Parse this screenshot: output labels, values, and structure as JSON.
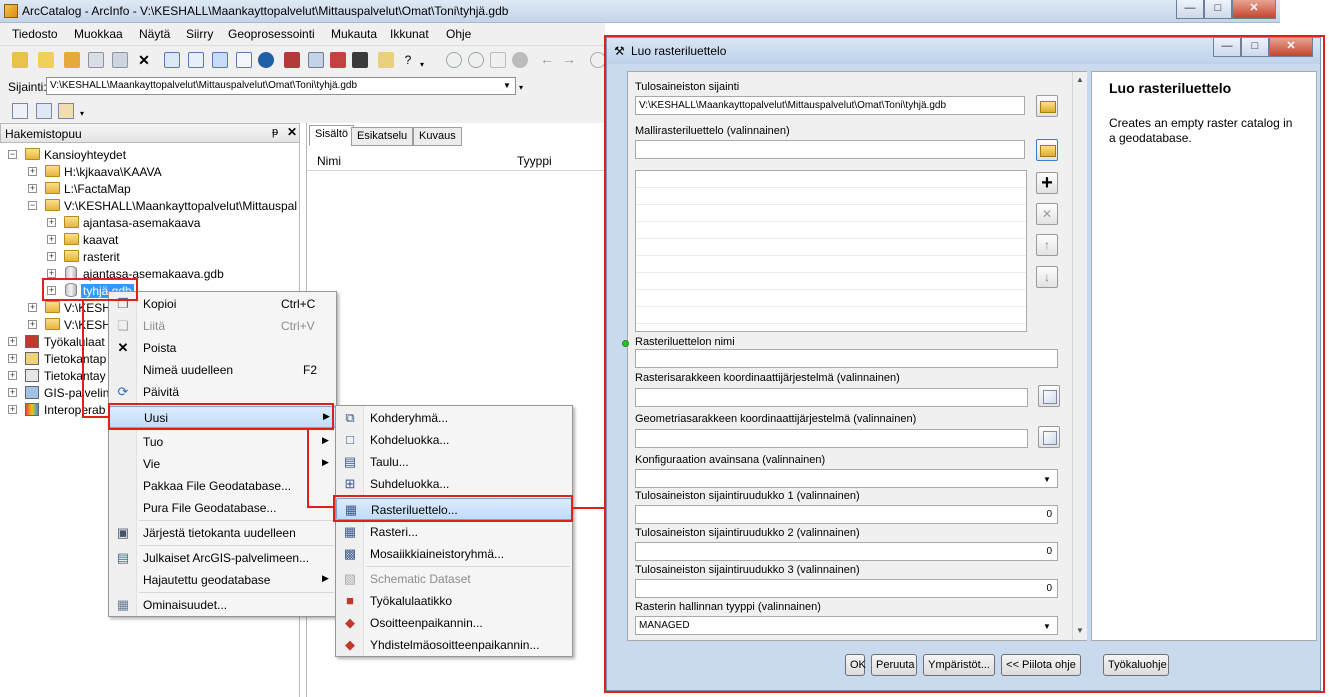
{
  "window": {
    "title": "ArcCatalog - ArcInfo - V:\\KESHALL\\Maankayttopalvelut\\Mittauspalvelut\\Omat\\Toni\\tyhjä.gdb",
    "btn_min": "—",
    "btn_max": "□",
    "btn_close": "✕"
  },
  "menubar": [
    "Tiedosto",
    "Muokkaa",
    "Näytä",
    "Siirry",
    "Geoprosessointi",
    "Mukauta",
    "Ikkunat",
    "Ohje"
  ],
  "location": {
    "label": "Sijainti:",
    "value": "V:\\KESHALL\\Maankayttopalvelut\\Mittauspalvelut\\Omat\\Toni\\tyhjä.gdb"
  },
  "tree": {
    "header": "Hakemistopuu",
    "pin": "📌",
    "close": "✕",
    "nodes": [
      {
        "label": "Kansioyhteydet"
      },
      {
        "label": "H:\\kjkaava\\KAAVA"
      },
      {
        "label": "L:\\FactaMap"
      },
      {
        "label": "V:\\KESHALL\\Maankayttopalvelut\\Mittauspal"
      },
      {
        "label": "ajantasa-asemakaava"
      },
      {
        "label": "kaavat"
      },
      {
        "label": "rasterit"
      },
      {
        "label": "ajantasa-asemakaava.gdb"
      },
      {
        "label": "tyhjä.gdb"
      },
      {
        "label": "V:\\KESHA"
      },
      {
        "label": "V:\\KESHA"
      },
      {
        "label": "Työkalulaat"
      },
      {
        "label": "Tietokantap"
      },
      {
        "label": "Tietokantay"
      },
      {
        "label": "GIS-palvelin"
      },
      {
        "label": "Interoperab"
      }
    ]
  },
  "content": {
    "tabs": [
      "Sisältö",
      "Esikatselu",
      "Kuvaus"
    ],
    "columns": [
      "Nimi",
      "Tyyppi"
    ]
  },
  "context_menu": [
    {
      "label": "Kopioi",
      "shortcut": "Ctrl+C",
      "icon": "copy-icon"
    },
    {
      "label": "Liitä",
      "shortcut": "Ctrl+V",
      "icon": "paste-icon"
    },
    {
      "label": "Poista",
      "shortcut": "",
      "icon": "delete-icon"
    },
    {
      "label": "Nimeä uudelleen",
      "shortcut": "F2",
      "icon": ""
    },
    {
      "label": "Päivitä",
      "shortcut": "",
      "icon": "refresh-icon"
    },
    {
      "label": "Uusi",
      "shortcut": "",
      "icon": ""
    },
    {
      "label": "Tuo",
      "shortcut": "",
      "icon": ""
    },
    {
      "label": "Vie",
      "shortcut": "",
      "icon": ""
    },
    {
      "label": "Pakkaa File Geodatabase...",
      "shortcut": "",
      "icon": ""
    },
    {
      "label": "Pura File Geodatabase...",
      "shortcut": "",
      "icon": ""
    },
    {
      "label": "Järjestä tietokanta uudelleen",
      "shortcut": "",
      "icon": "reorganize-icon"
    },
    {
      "label": "Julkaiset ArcGIS-palvelimeen...",
      "shortcut": "",
      "icon": "publish-icon"
    },
    {
      "label": "Hajautettu geodatabase",
      "shortcut": "",
      "icon": ""
    },
    {
      "label": "Ominaisuudet...",
      "shortcut": "",
      "icon": "properties-icon"
    }
  ],
  "submenu": [
    {
      "label": "Kohderyhmä...",
      "icon": "feature-dataset-icon"
    },
    {
      "label": "Kohdeluokka...",
      "icon": "feature-class-icon"
    },
    {
      "label": "Taulu...",
      "icon": "table-icon"
    },
    {
      "label": "Suhdeluokka...",
      "icon": "relationship-class-icon"
    },
    {
      "label": "Rasteriluettelo...",
      "icon": "raster-catalog-icon"
    },
    {
      "label": "Rasteri...",
      "icon": "raster-icon"
    },
    {
      "label": "Mosaiikkiaineistoryhmä...",
      "icon": "mosaic-dataset-icon"
    },
    {
      "label": "Schematic Dataset",
      "icon": "schematic-icon"
    },
    {
      "label": "Työkalulaatikko",
      "icon": "toolbox-icon"
    },
    {
      "label": "Osoitteenpaikannin...",
      "icon": "locator-icon"
    },
    {
      "label": "Yhdistelmäosoitteenpaikannin...",
      "icon": "composite-locator-icon"
    }
  ],
  "dialog": {
    "title": "Luo rasteriluettelo",
    "fields": {
      "output_location_label": "Tulosaineiston sijainti",
      "output_location_value": "V:\\KESHALL\\Maankayttopalvelut\\Mittauspalvelut\\Omat\\Toni\\tyhjä.gdb",
      "template_label": "Mallirasteriluettelo (valinnainen)",
      "name_label": "Rasteriluettelon nimi",
      "raster_cs_label": "Rasterisarakkeen koordinaattijärjestelmä  (valinnainen)",
      "geom_cs_label": "Geometriasarakkeen koordinaattijärjestelmä (valinnainen)",
      "config_label": "Konfiguraation avainsana (valinnainen)",
      "grid1_label": "Tulosaineiston sijaintiruudukko 1 (valinnainen)",
      "grid1_value": "0",
      "grid2_label": "Tulosaineiston sijaintiruudukko 2 (valinnainen)",
      "grid2_value": "0",
      "grid3_label": "Tulosaineiston sijaintiruudukko 3 (valinnainen)",
      "grid3_value": "0",
      "mgmt_label": "Rasterin hallinnan tyyppi (valinnainen)",
      "mgmt_value": "MANAGED"
    },
    "help_title": "Luo rasteriluettelo",
    "help_text": "Creates an empty raster catalog in a geodatabase.",
    "buttons": {
      "ok": "OK",
      "cancel": "Peruuta",
      "env": "Ympäristöt...",
      "hide_help": "<< Piilota ohje",
      "tool_help": "Työkaluohje"
    }
  },
  "colors": {
    "annotation_red": "#e0201c",
    "highlight_blue": "#c1dcf9"
  }
}
